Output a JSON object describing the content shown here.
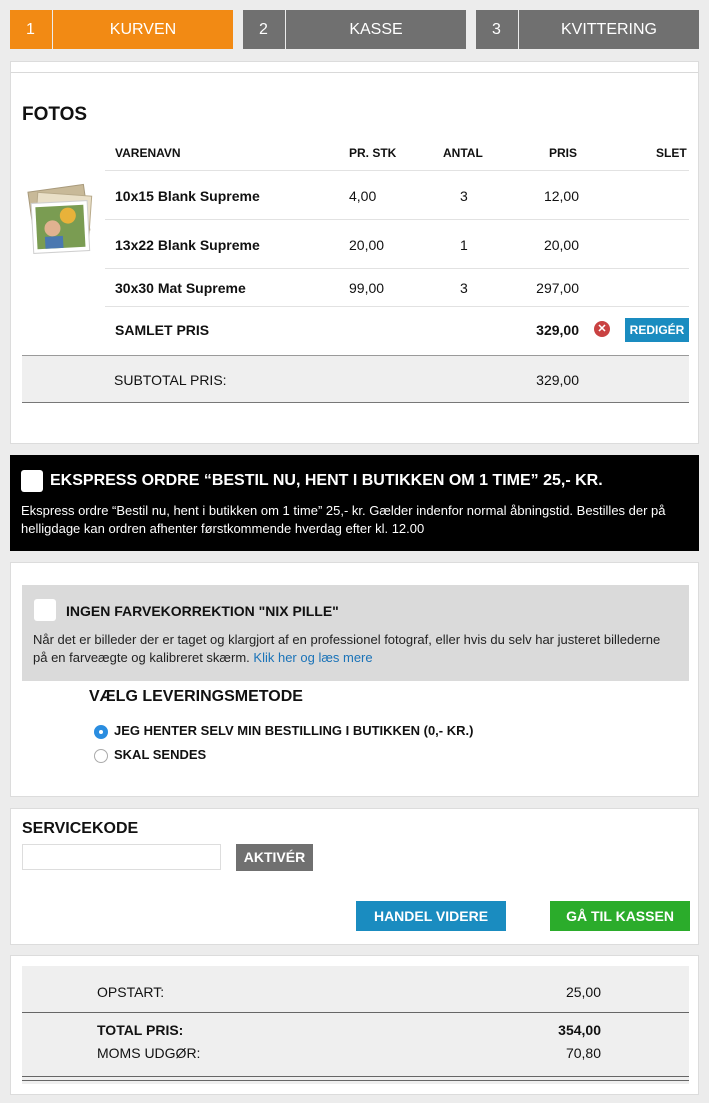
{
  "steps": [
    {
      "num": "1",
      "label": "KURVEN",
      "color": "#f28a14"
    },
    {
      "num": "2",
      "label": "KASSE",
      "color": "#707070"
    },
    {
      "num": "3",
      "label": "KVITTERING",
      "color": "#707070"
    }
  ],
  "cart": {
    "title": "FOTOS",
    "headers": {
      "name": "VARENAVN",
      "price_each": "PR. STK",
      "qty": "ANTAL",
      "price": "PRIS",
      "delete": "SLET"
    },
    "items": [
      {
        "name": "10x15 Blank Supreme",
        "price_each": "4,00",
        "qty": "3",
        "price": "12,00"
      },
      {
        "name": "13x22 Blank Supreme",
        "price_each": "20,00",
        "qty": "1",
        "price": "20,00"
      },
      {
        "name": "30x30 Mat Supreme",
        "price_each": "99,00",
        "qty": "3",
        "price": "297,00"
      }
    ],
    "total_label": "SAMLET PRIS",
    "total_value": "329,00",
    "edit_label": "REDIGÉR",
    "subtotal_label": "SUBTOTAL PRIS:",
    "subtotal_value": "329,00"
  },
  "express": {
    "title": "EKSPRESS ORDRE “BESTIL NU, HENT I BUTIKKEN OM 1 TIME” 25,- KR.",
    "description": "Ekspress ordre “Bestil nu, hent i butikken om 1 time” 25,- kr. Gælder indenfor normal åbningstid. Bestilles der på helligdage kan ordren afhenter førstkommende hverdag efter kl. 12.00",
    "checked": false
  },
  "nix": {
    "title": "INGEN FARVEKORREKTION \"NIX PILLE\"",
    "description": "Når det er billeder der er taget og klargjort af en professionel fotograf, eller hvis du selv har justeret billederne på en farveægte og kalibreret skærm.",
    "link": "Klik her og læs mere",
    "checked": false
  },
  "delivery": {
    "title": "VÆLG LEVERINGSMETODE",
    "options": [
      {
        "label": "JEG HENTER SELV MIN BESTILLING I BUTIKKEN (0,- KR.)",
        "selected": true
      },
      {
        "label": "SKAL SENDES",
        "selected": false
      }
    ]
  },
  "service": {
    "title": "SERVICEKODE",
    "input_value": "",
    "activate_label": "AKTIVÉR",
    "continue_label": "HANDEL VIDERE",
    "checkout_label": "GÅ TIL KASSEN"
  },
  "totals": {
    "startup_label": "OPSTART:",
    "startup_value": "25,00",
    "total_label": "TOTAL PRIS:",
    "total_value": "354,00",
    "vat_label": "MOMS UDGØR:",
    "vat_value": "70,80"
  }
}
